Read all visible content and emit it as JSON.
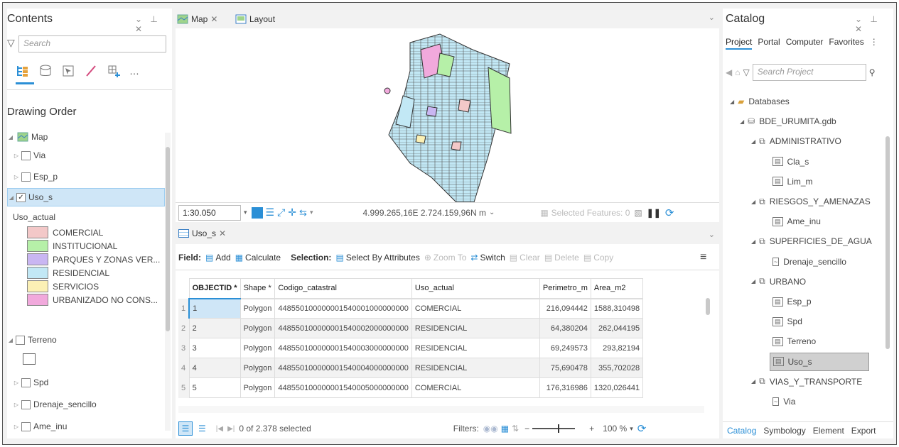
{
  "contents": {
    "title": "Contents",
    "search_placeholder": "Search",
    "section_title": "Drawing Order",
    "layers": [
      {
        "label": "Map",
        "checked": false
      },
      {
        "label": "Via",
        "checked": false
      },
      {
        "label": "Esp_p",
        "checked": false
      },
      {
        "label": "Uso_s",
        "checked": true
      }
    ],
    "legend_title": "Uso_actual",
    "legend": [
      {
        "label": "COMERCIAL",
        "color": "#f3c8c8"
      },
      {
        "label": "INSTITUCIONAL",
        "color": "#b6f0a8"
      },
      {
        "label": "PARQUES Y ZONAS VER...",
        "color": "#c9b6f2"
      },
      {
        "label": "RESIDENCIAL",
        "color": "#c2e8f5"
      },
      {
        "label": "SERVICIOS",
        "color": "#fbf0b5"
      },
      {
        "label": "URBANIZADO NO CONS...",
        "color": "#f1a9dc"
      }
    ],
    "terreno": "Terreno",
    "layers2": [
      "Spd",
      "Drenaje_sencillo",
      "Ame_inu"
    ]
  },
  "tabs": {
    "map": "Map",
    "layout": "Layout"
  },
  "mapbar": {
    "scale": "1:30.050",
    "coords": "4.999.265,16E 2.724.159,96N m",
    "selected": "Selected Features: 0"
  },
  "table": {
    "tab": "Uso_s",
    "field_label": "Field:",
    "add": "Add",
    "calculate": "Calculate",
    "selection_label": "Selection:",
    "select_by_attr": "Select By Attributes",
    "zoom_to": "Zoom To",
    "switch": "Switch",
    "clear": "Clear",
    "delete": "Delete",
    "copy": "Copy",
    "columns": [
      "OBJECTID *",
      "Shape *",
      "Codigo_catastral",
      "Uso_actual",
      "Perimetro_m",
      "Area_m2"
    ],
    "rows": [
      {
        "idx": "1",
        "oid": "1",
        "shape": "Polygon",
        "codigo": "448550100000001540001000000000",
        "uso": "COMERCIAL",
        "perim": "216,094442",
        "area": "1588,310498"
      },
      {
        "idx": "2",
        "oid": "2",
        "shape": "Polygon",
        "codigo": "448550100000001540002000000000",
        "uso": "RESIDENCIAL",
        "perim": "64,380204",
        "area": "262,044195"
      },
      {
        "idx": "3",
        "oid": "3",
        "shape": "Polygon",
        "codigo": "448550100000001540003000000000",
        "uso": "RESIDENCIAL",
        "perim": "69,249573",
        "area": "293,82194"
      },
      {
        "idx": "4",
        "oid": "4",
        "shape": "Polygon",
        "codigo": "448550100000001540004000000000",
        "uso": "RESIDENCIAL",
        "perim": "75,690478",
        "area": "355,702028"
      },
      {
        "idx": "5",
        "oid": "5",
        "shape": "Polygon",
        "codigo": "448550100000001540005000000000",
        "uso": "COMERCIAL",
        "perim": "176,316986",
        "area": "1320,026441"
      }
    ],
    "status": "0 of 2.378 selected",
    "filters": "Filters:",
    "zoom": "100 %"
  },
  "catalog": {
    "title": "Catalog",
    "tabs": [
      "Project",
      "Portal",
      "Computer",
      "Favorites"
    ],
    "search_placeholder": "Search Project",
    "items": [
      {
        "label": "Databases",
        "level": 0,
        "kind": "db"
      },
      {
        "label": "BDE_URUMITA.gdb",
        "level": 1,
        "kind": "gdb"
      },
      {
        "label": "ADMINISTRATIVO",
        "level": 2,
        "kind": "fds"
      },
      {
        "label": "Cla_s",
        "level": 3,
        "kind": "fc"
      },
      {
        "label": "Lim_m",
        "level": 3,
        "kind": "fc"
      },
      {
        "label": "RIESGOS_Y_AMENAZAS",
        "level": 2,
        "kind": "fds"
      },
      {
        "label": "Ame_inu",
        "level": 3,
        "kind": "fc"
      },
      {
        "label": "SUPERFICIES_DE_AGUA",
        "level": 2,
        "kind": "fds"
      },
      {
        "label": "Drenaje_sencillo",
        "level": 3,
        "kind": "line"
      },
      {
        "label": "URBANO",
        "level": 2,
        "kind": "fds"
      },
      {
        "label": "Esp_p",
        "level": 3,
        "kind": "fc"
      },
      {
        "label": "Spd",
        "level": 3,
        "kind": "fc"
      },
      {
        "label": "Terreno",
        "level": 3,
        "kind": "fc"
      },
      {
        "label": "Uso_s",
        "level": 3,
        "kind": "fc",
        "selected": true
      },
      {
        "label": "VIAS_Y_TRANSPORTE",
        "level": 2,
        "kind": "fds"
      },
      {
        "label": "Via",
        "level": 3,
        "kind": "line"
      }
    ],
    "bottom_tabs": [
      "Catalog",
      "Symbology",
      "Element",
      "Export"
    ]
  }
}
